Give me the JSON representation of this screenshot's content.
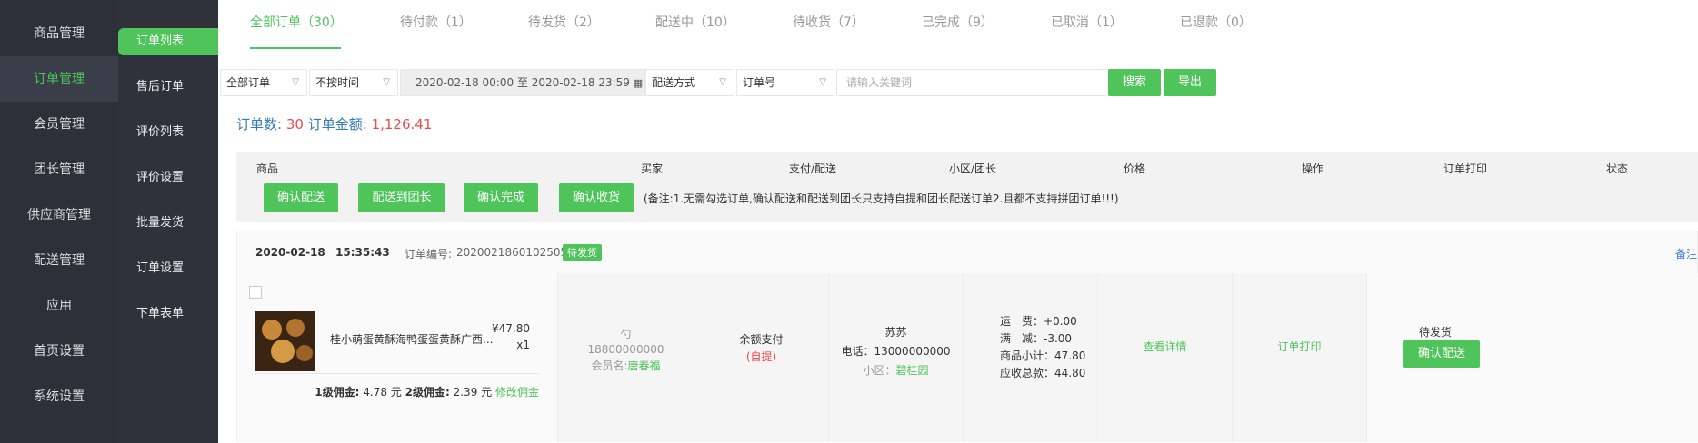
{
  "sidebar_primary": [
    "商品管理",
    "订单管理",
    "会员管理",
    "团长管理",
    "供应商管理",
    "配送管理",
    "应用",
    "首页设置",
    "系统设置"
  ],
  "sidebar_secondary": [
    "订单列表",
    "售后订单",
    "评价列表",
    "评价设置",
    "批量发货",
    "订单设置",
    "下单表单"
  ],
  "tabs": [
    "全部订单（30）",
    "待付款（1）",
    "待发货（2）",
    "配送中（10）",
    "待收货（7）",
    "已完成（9）",
    "已取消（1）",
    "已退款（0）"
  ],
  "filters": {
    "order_type": "全部订单",
    "time_type": "不按时间",
    "date_range": "2020-02-18 00:00 至 2020-02-18 23:59",
    "delivery": "配送方式",
    "search_field": "订单号",
    "keyword_placeholder": "请输入关键词",
    "search_btn": "搜索",
    "export_btn": "导出"
  },
  "summary": {
    "count_label": "订单数:",
    "count": "30",
    "amount_label": "订单金额:",
    "amount": "1,126.41"
  },
  "columns": [
    "商品",
    "买家",
    "支付/配送",
    "小区/团长",
    "价格",
    "操作",
    "订单打印",
    "状态"
  ],
  "batch_buttons": [
    "确认配送",
    "配送到团长",
    "确认完成",
    "确认收货"
  ],
  "batch_note": "(备注:1.无需勾选订单,确认配送和配送到团长只支持自提和团长配送订单2.且都不支持拼团订单!!!)",
  "order": {
    "date": "2020-02-18",
    "time": "15:35:43",
    "order_no_label": "订单编号:",
    "order_no": "202002186010250545",
    "status_badge": "待发货",
    "remark": "备注",
    "product_name": "桂小萌蛋黄酥海鸭蛋蛋黄酥广西...",
    "product_price": "¥47.80",
    "product_qty": "x1",
    "commission1_label": "1级佣金:",
    "commission1": "4.78 元",
    "commission2_label": "2级佣金:",
    "commission2": "2.39 元",
    "modify_commission": "修改佣金",
    "buyer_name": "勺",
    "buyer_phone": "18800000000",
    "member_label": "会员名:",
    "member_name": "唐春福",
    "pay_method": "余额支付",
    "delivery_method": "(自提)",
    "leader_name": "苏苏",
    "leader_phone_label": "电话：",
    "leader_phone": "13000000000",
    "community_label": "小区：",
    "community": "碧桂园",
    "freight_label": "运　费：",
    "freight": "+0.00",
    "discount_label": "满　减：",
    "discount": "-3.00",
    "subtotal_label": "商品小计：",
    "subtotal": "47.80",
    "total_label": "应收总款：",
    "total": "44.80",
    "view_detail": "查看详情",
    "print": "订单打印",
    "status": "待发货",
    "confirm_btn": "确认配送"
  }
}
